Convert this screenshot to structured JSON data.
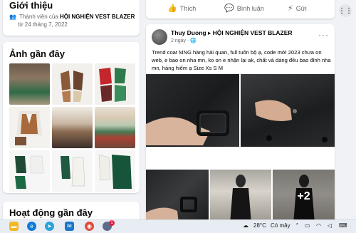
{
  "intro": {
    "title": "Giới thiệu",
    "member_prefix": "Thành viên của",
    "group_name": "HỘI NGHIỆN VEST BLAZER",
    "member_since": "từ 24 tháng 7, 2022"
  },
  "photos": {
    "title": "Ảnh gần đây"
  },
  "activity": {
    "title": "Hoạt động gần đây"
  },
  "actions": {
    "like": "Thích",
    "comment": "Bình luận",
    "share": "Gửi"
  },
  "post": {
    "author": "Thuy Duong",
    "arrow": "▸",
    "group": "HỘI NGHIỆN VEST BLAZER",
    "time": "2 ngày",
    "more": "···",
    "text": "Trend coat MNG hàng hải quan, full tuôn bộ ạ, code mới 2023 chưa on web, e bao on nha mn, ko on e nhận lại ak, chất và dáng đều bao đỉnh nha mn, hàng hiếm ạ Size Xs S M",
    "extra_count": "+2"
  },
  "taskbar": {
    "weather": "28°C",
    "weather_desc": "Có mây",
    "badge": "1"
  },
  "icons": {
    "intro_members": "group-icon",
    "like": "thumbs-up-icon",
    "comment": "comment-icon",
    "share": "messenger-icon",
    "apps": "grid-menu-icon"
  }
}
